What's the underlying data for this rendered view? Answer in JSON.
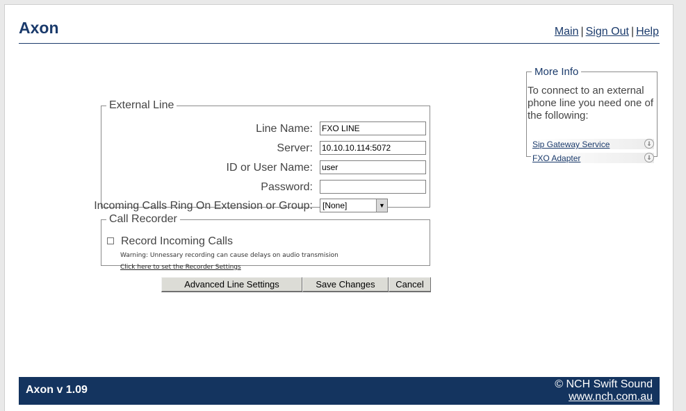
{
  "header": {
    "title": "Axon",
    "links": {
      "main": "Main",
      "sign_out": "Sign Out",
      "help": "Help",
      "separator": "|"
    }
  },
  "external_line": {
    "legend": "External Line",
    "fields": {
      "line_name": {
        "label": "Line Name:",
        "value": "FXO LINE"
      },
      "server": {
        "label": "Server:",
        "value": "10.10.10.114:5072"
      },
      "user_name": {
        "label": "ID or User Name:",
        "value": "user"
      },
      "password": {
        "label": "Password:",
        "value": ""
      },
      "ring_on": {
        "label": "Incoming Calls Ring On Extension or Group:",
        "selected": "[None]"
      }
    }
  },
  "call_recorder": {
    "legend": "Call Recorder",
    "checkbox_label": "Record Incoming Calls",
    "checked": false,
    "warning": "Warning: Unnessary recording can cause delays on audio transmision",
    "settings_link": "Click here to set the Recorder Settings"
  },
  "buttons": {
    "advanced": "Advanced Line Settings",
    "save": "Save Changes",
    "cancel": "Cancel"
  },
  "more_info": {
    "legend": "More Info",
    "text": "To connect to an external phone line you need one of the following:",
    "links": [
      "Sip Gateway Service",
      "FXO Adapter"
    ],
    "expand_icon": "double-chevron-down-icon"
  },
  "footer": {
    "version": "Axon v 1.09",
    "copyright": "© NCH Swift Sound",
    "url": "www.nch.com.au"
  },
  "colors": {
    "brand": "#1a3a6b",
    "footer_bg": "#14345f"
  }
}
